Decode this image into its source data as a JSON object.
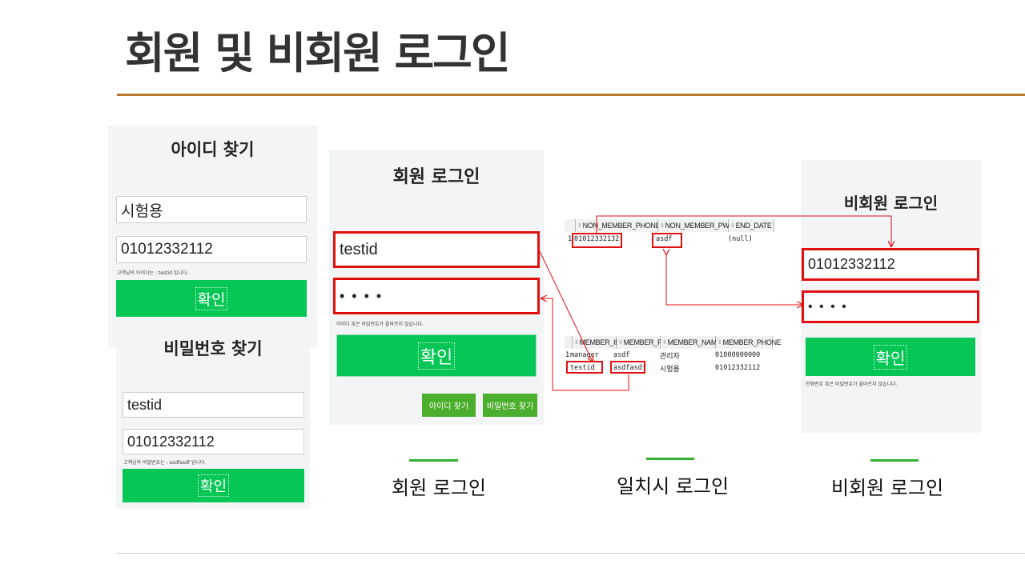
{
  "slide": {
    "title": "회원 및 비회원 로그인",
    "accent_color": "#b87a2c"
  },
  "find_id": {
    "title": "아이디 찾기",
    "name_value": "시험용",
    "phone_value": "01012332112",
    "result_note": "고객님의 아이디는 : testid 입니다.",
    "confirm_label": "확인"
  },
  "find_pw": {
    "title": "비밀번호 찾기",
    "id_value": "testid",
    "phone_value": "01012332112",
    "result_note": "고객님의 비밀번호는 : asdfasdf 입니다.",
    "confirm_label": "확인"
  },
  "member_login": {
    "title": "회원 로그인",
    "id_value": "testid",
    "password_mask": "• • • •",
    "error_note": "아이디 혹은 비밀번호가 올바르지 않습니다.",
    "login_label": "확인",
    "find_id_label": "아이디 찾기",
    "find_pw_label": "비밀번호 찾기"
  },
  "non_member_table": {
    "columns": [
      "NON_MEMBER_PHONE",
      "NON_MEMBER_PW",
      "END_DATE"
    ],
    "rows": [
      {
        "num": "1",
        "phone": "01012332132",
        "pw": "asdf",
        "end_date": "(null)"
      }
    ]
  },
  "member_table": {
    "columns": [
      "MEMBER_ID",
      "MEMBER_PW",
      "MEMBER_NAME",
      "MEMBER_PHONE"
    ],
    "rows": [
      {
        "num": "1",
        "id": "manager",
        "pw": "asdf",
        "name": "관리자",
        "phone": "01000000000"
      },
      {
        "num": "2",
        "id": "testid",
        "pw": "asdfasdf",
        "name": "시험용",
        "phone": "01012332112"
      }
    ]
  },
  "non_member_login": {
    "title": "비회원 로그인",
    "phone_value": "01012332112",
    "password_mask": "• • • •",
    "confirm_label": "확인",
    "error_note": "전화번호 혹은 비밀번호가 올바르지 않습니다."
  },
  "captions": {
    "member": "회원 로그인",
    "match": "일치시 로그인",
    "non_member": "비회원 로그인"
  },
  "colors": {
    "highlight": "#e01010",
    "button_green": "#06c755",
    "small_button_green": "#4cae2d",
    "caption_bar": "#34b233"
  }
}
